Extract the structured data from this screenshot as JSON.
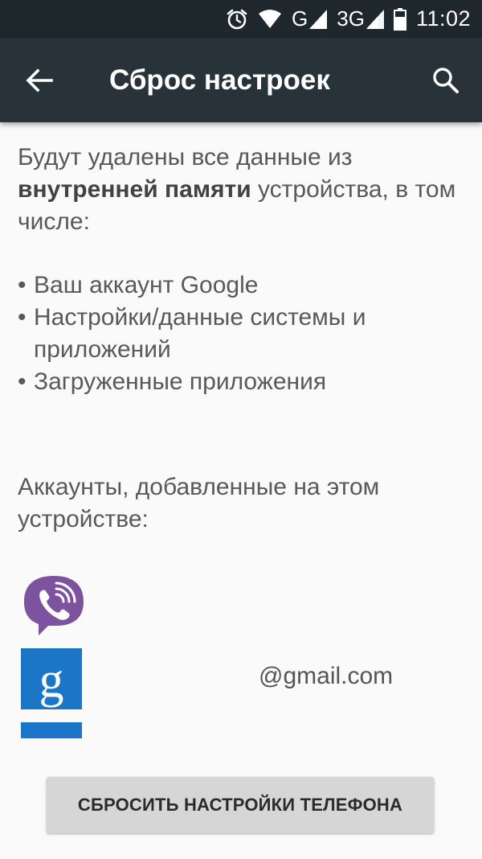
{
  "status_bar": {
    "network_1": "G",
    "network_2": "3G",
    "time": "11:02",
    "icons": [
      "alarm-icon",
      "wifi-icon",
      "signal-icon",
      "signal-icon",
      "battery-icon"
    ]
  },
  "app_bar": {
    "title": "Сброс настроек",
    "back_icon": "arrow-left-icon",
    "search_icon": "search-icon"
  },
  "content": {
    "intro_prefix": "Будут удалены все данные из ",
    "intro_bold": "внутренней памяти",
    "intro_suffix": " устройства, в том числе:",
    "bullets": [
      "Ваш аккаунт Google",
      "Настройки/данные системы и приложений",
      "Загруженные приложения"
    ],
    "accounts_title": "Аккаунты, добавленные на этом устройстве:"
  },
  "accounts": [
    {
      "app": "viber-icon",
      "label": ""
    },
    {
      "app": "google-icon",
      "label": "@gmail.com"
    },
    {
      "app": "google-icon",
      "label": ""
    }
  ],
  "colors": {
    "status_bar": "#1e272c",
    "app_bar": "#283339",
    "viber": "#7d529f",
    "google": "#1c76c8",
    "button": "#d6d6d6"
  },
  "footer": {
    "reset_button": "СБРОСИТЬ НАСТРОЙКИ ТЕЛЕФОНА"
  }
}
